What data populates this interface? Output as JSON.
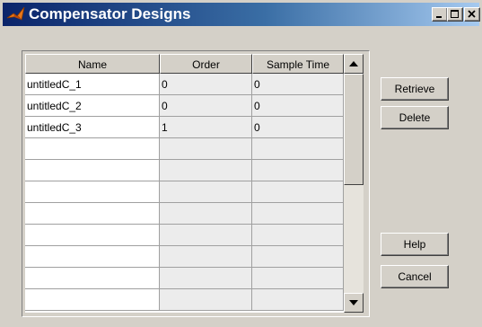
{
  "window": {
    "title": "Compensator Designs",
    "controls": [
      "minimize-icon",
      "maximize-icon",
      "close-icon"
    ]
  },
  "table": {
    "columns": [
      "Name",
      "Order",
      "Sample Time"
    ],
    "rows": [
      [
        "untitledC_1",
        "0",
        "0"
      ],
      [
        "untitledC_2",
        "0",
        "0"
      ],
      [
        "untitledC_3",
        "1",
        "0"
      ],
      [
        "",
        "",
        ""
      ],
      [
        "",
        "",
        ""
      ],
      [
        "",
        "",
        ""
      ],
      [
        "",
        "",
        ""
      ],
      [
        "",
        "",
        ""
      ],
      [
        "",
        "",
        ""
      ],
      [
        "",
        "",
        ""
      ],
      [
        "",
        "",
        ""
      ]
    ]
  },
  "buttons": {
    "retrieve": "Retrieve",
    "delete": "Delete",
    "help": "Help",
    "cancel": "Cancel"
  },
  "colors": {
    "titlebar_start": "#0a246a",
    "titlebar_end": "#a6caf0",
    "face": "#d4d0c8"
  }
}
